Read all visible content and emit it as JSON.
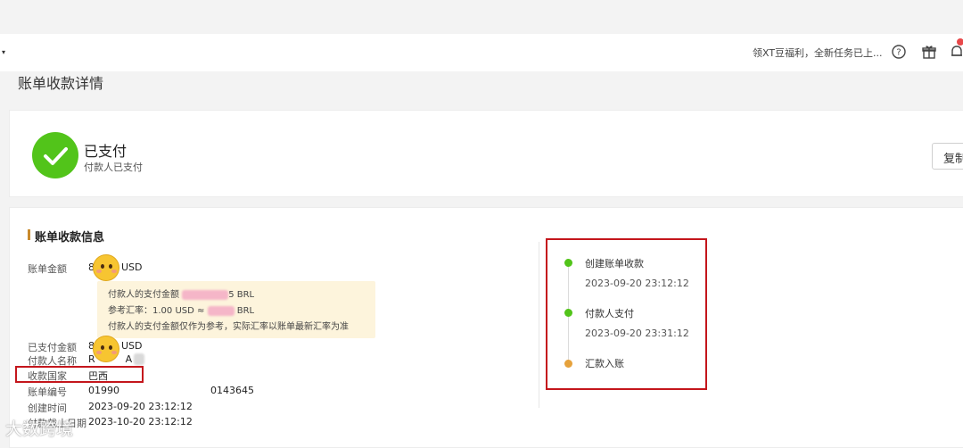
{
  "topbar": {
    "promo_text": "领XT豆福利，全新任务已上...",
    "icons": [
      "help-icon",
      "gift-icon",
      "bell-icon"
    ],
    "notification_color": "#e8484a"
  },
  "page": {
    "title": "账单收款详情"
  },
  "status": {
    "title": "已支付",
    "subtitle": "付款人已支付",
    "copy_button_label": "复制",
    "color": "#52c41a"
  },
  "info": {
    "section_title": "账单收款信息",
    "fields": {
      "bill_amount_label": "账单金额",
      "bill_amount_prefix": "8",
      "bill_amount_suffix": "USD",
      "paid_amount_label": "已支付金额",
      "paid_amount_prefix": "8",
      "paid_amount_suffix": "USD",
      "payer_name_label": "付款人名称",
      "payer_name_prefix": "R",
      "payer_name_suffix": "A",
      "country_label": "收款国家",
      "country_value": "巴西",
      "bill_no_label": "账单编号",
      "bill_no_part1": "01990",
      "bill_no_part2": "0143645",
      "created_label": "创建时间",
      "created_value": "2023-09-20 23:12:12",
      "deadline_label": "付款截止日期",
      "deadline_value": "2023-10-20 23:12:12"
    },
    "tooltip": {
      "line1_prefix": "付款人的支付金额",
      "line1_suffix": "5 BRL",
      "line2_prefix": "参考汇率：1.00 USD ≈",
      "line2_suffix": "BRL",
      "line3": "付款人的支付金额仅作为参考，实际汇率以账单最新汇率为准"
    }
  },
  "timeline": {
    "steps": [
      {
        "label": "创建账单收款",
        "time": "2023-09-20 23:12:12",
        "color": "#52c41a"
      },
      {
        "label": "付款人支付",
        "time": "2023-09-20 23:31:12",
        "color": "#52c41a"
      },
      {
        "label": "汇款入账",
        "time": "",
        "color": "#e6a23c"
      }
    ]
  },
  "watermark": {
    "text": "大数跨境"
  },
  "colors": {
    "accent": "#52c41a",
    "highlight_red": "#c4161c",
    "section_bar": "#c98a2c"
  }
}
